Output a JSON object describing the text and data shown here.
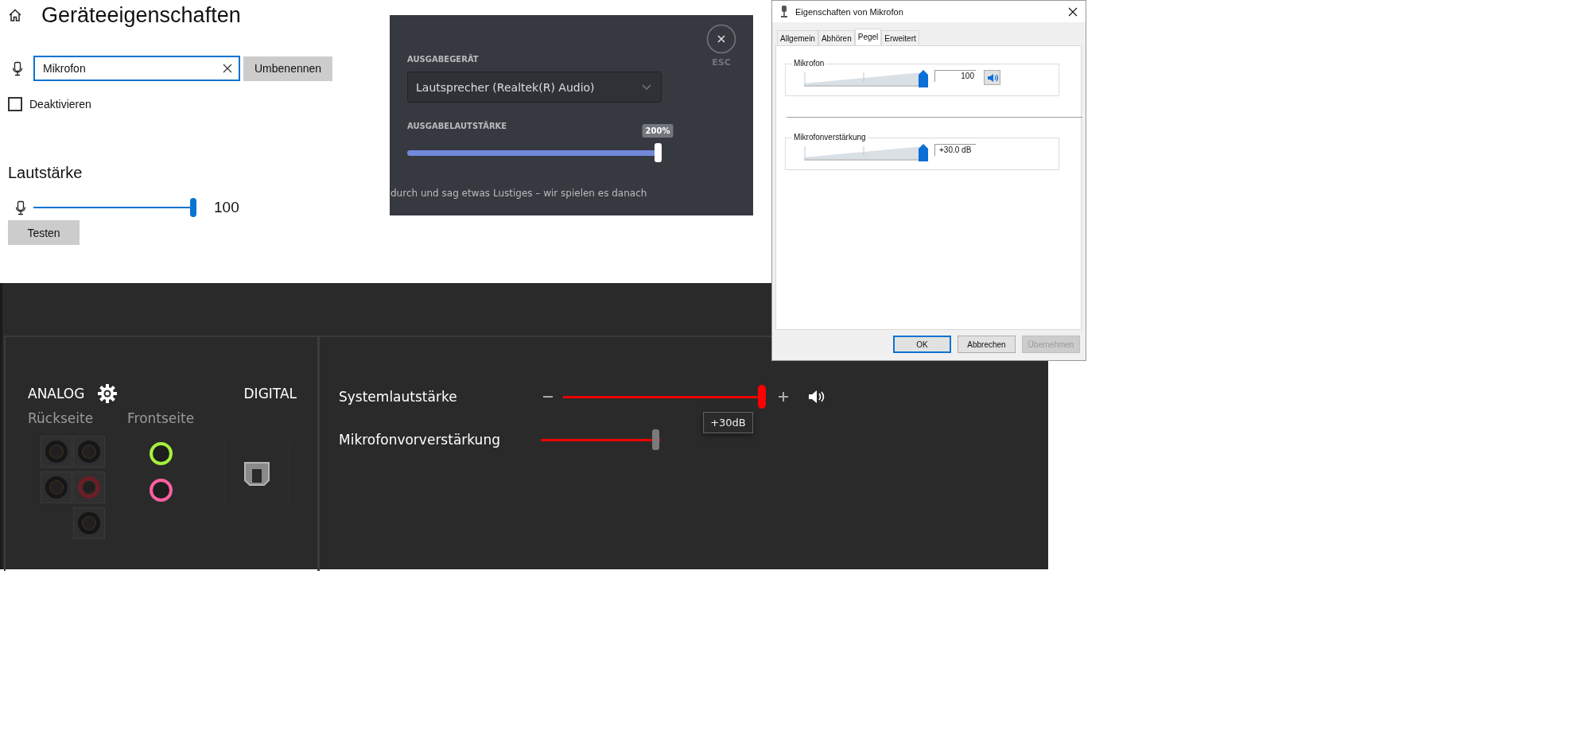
{
  "settings": {
    "title": "Geräteeigenschaften",
    "name_field": {
      "value": "Mikrofon"
    },
    "rename_button": "Umbenennen",
    "disable_checkbox": {
      "label": "Deaktivieren",
      "checked": false
    },
    "volume_heading": "Lautstärke",
    "volume": {
      "level": 1,
      "reading": "100"
    },
    "test_button": "Testen"
  },
  "discord": {
    "close_label": "ESC",
    "output_device_label": "AUSGABEGERÄT",
    "output_device": "Lautsprecher (Realtek(R) Audio)",
    "output_volume_label": "AUSGABELAUTSTÄRKE",
    "output_volume": {
      "level": 1,
      "tooltip": "200%"
    },
    "footer_text": "durch und sag etwas Lustiges – wir spielen es danach"
  },
  "dialog": {
    "title": "Eigenschaften von Mikrofon",
    "tabs": [
      {
        "label": "Allgemein",
        "selected": false
      },
      {
        "label": "Abhören",
        "selected": false
      },
      {
        "label": "Pegel",
        "selected": true
      },
      {
        "label": "Erweitert",
        "selected": false
      }
    ],
    "groups": [
      {
        "label": "Mikrofon",
        "level": 1,
        "value": "100",
        "kind": "with-speaker"
      },
      {
        "label": "Mikrofonverstärkung",
        "level": 1,
        "value": "+30.0 dB",
        "kind": "plain"
      }
    ],
    "buttons": [
      {
        "label": "OK",
        "kind": "default"
      },
      {
        "label": "Abbrechen",
        "kind": "normal"
      },
      {
        "label": "Übernehmen",
        "kind": "disabled"
      }
    ]
  },
  "realtek": {
    "analog_label": "ANALOG",
    "digital_label": "DIGITAL",
    "rear_label": "Rückseite",
    "front_label": "Frontseite",
    "rear_jacks": [
      {
        "color": "#161616"
      },
      {
        "color": "#161616"
      },
      {
        "color": "#161616"
      },
      {
        "color": "#6a1e26"
      },
      {
        "color": "#161616"
      }
    ],
    "front_jacks": [
      {
        "color": "#a6f03c"
      },
      {
        "color": "#ff5fa0"
      }
    ],
    "sliders": [
      {
        "label": "Systemlautstärke",
        "level": 1,
        "kind": "system",
        "tooltip": "+30dB"
      },
      {
        "label": "Mikrofonvorverstärkung",
        "level": 1,
        "kind": "mic"
      }
    ]
  }
}
